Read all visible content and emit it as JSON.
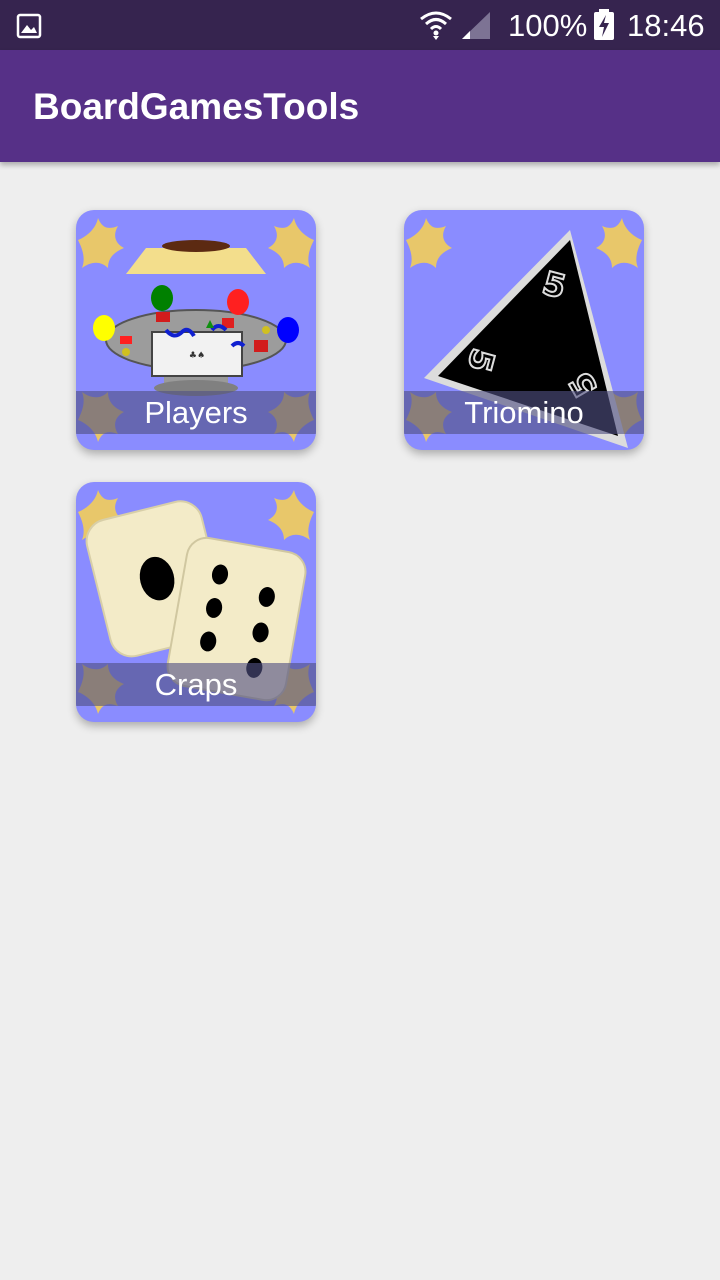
{
  "status_bar": {
    "icons": [
      "gallery-icon",
      "wifi-icon",
      "cellular-signal-icon",
      "battery-charging-icon"
    ],
    "battery_percent": "100%",
    "time": "18:46"
  },
  "app_bar": {
    "title": "BoardGamesTools"
  },
  "colors": {
    "status_bar": "#36244f",
    "app_bar": "#563087",
    "background": "#eeeeee",
    "tile_background": "#8a8cff"
  },
  "tiles": [
    {
      "label": "Players",
      "icon": "players-table-icon"
    },
    {
      "label": "Triomino",
      "icon": "triomino-tile-icon"
    },
    {
      "label": "Craps",
      "icon": "dice-icon"
    }
  ]
}
